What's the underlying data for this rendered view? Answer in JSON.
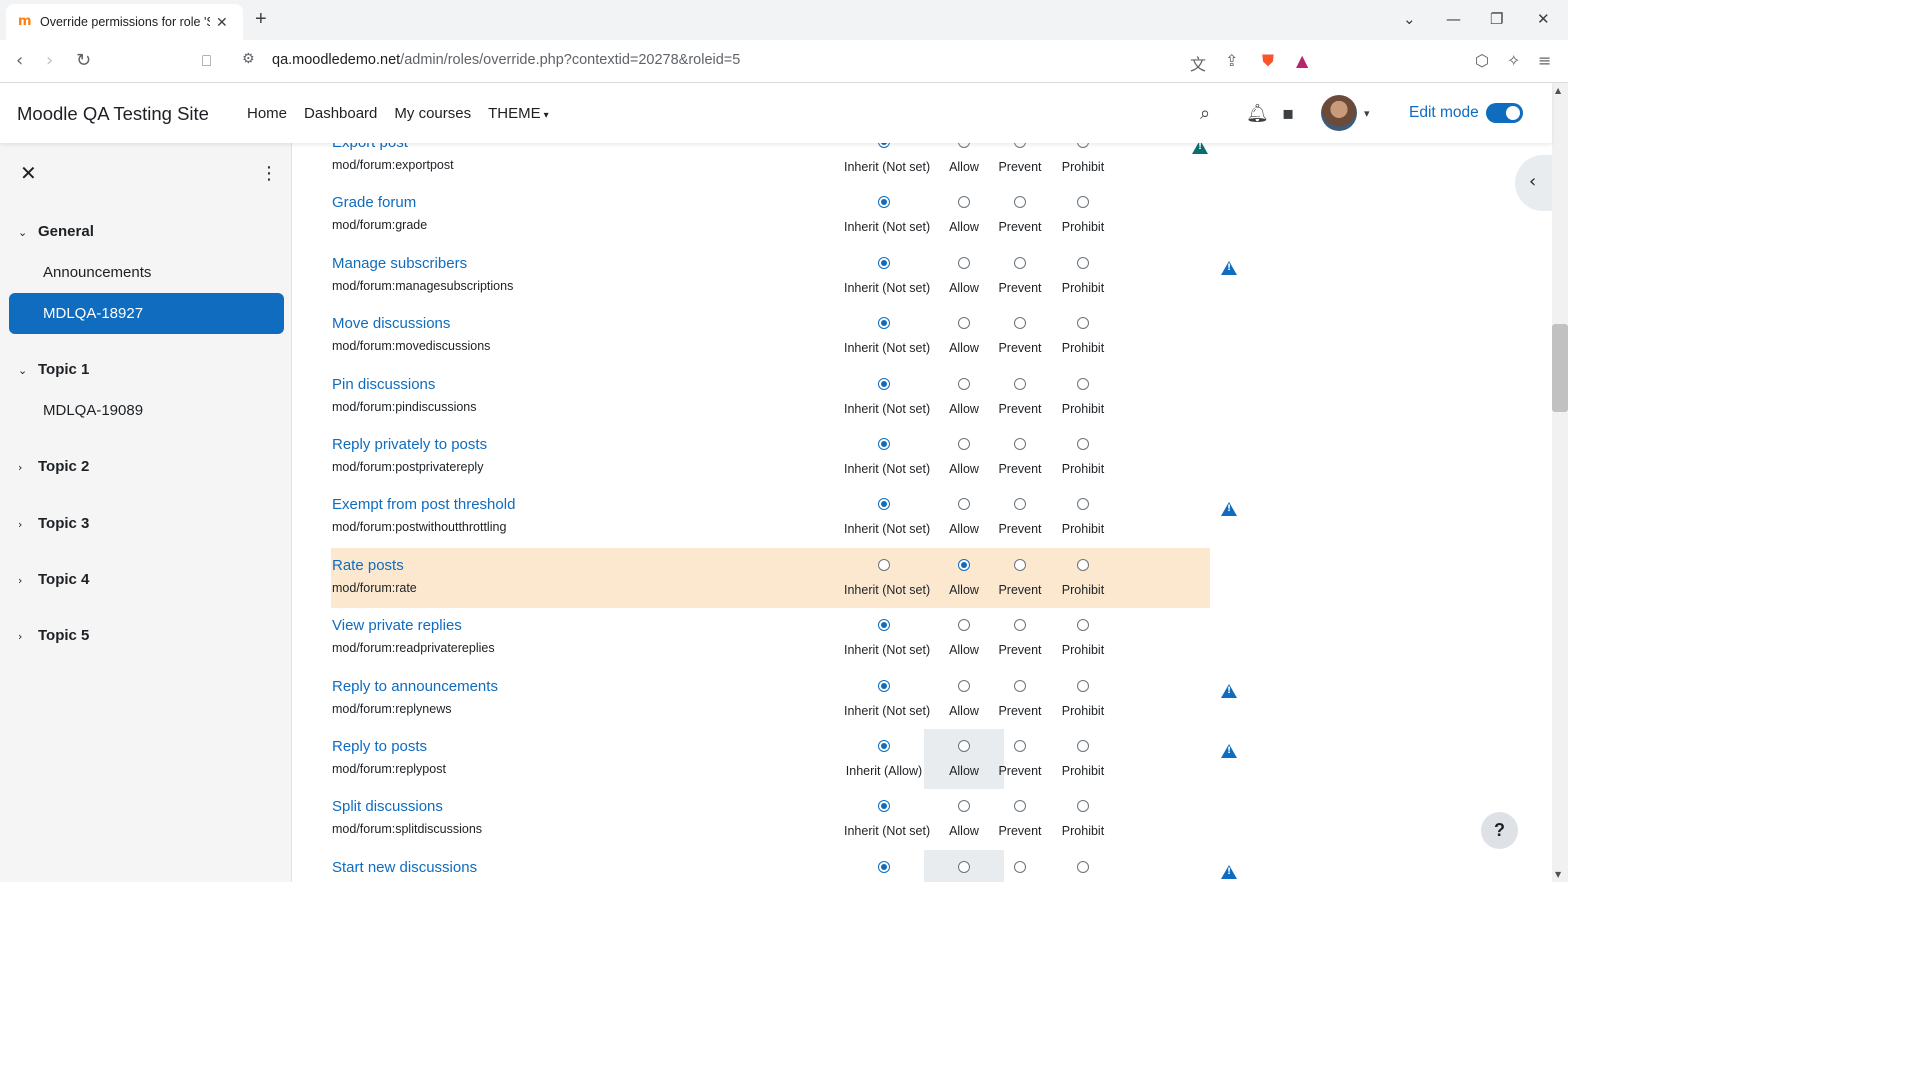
{
  "browser": {
    "tab_title": "Override permissions for role 'S",
    "favicon": "m",
    "url_host": "qa.moodledemo.net",
    "url_path": "/admin/roles/override.php?contextid=20278&roleid=5"
  },
  "header": {
    "site_name": "Moodle QA Testing Site",
    "nav": [
      "Home",
      "Dashboard",
      "My courses",
      "THEME"
    ],
    "edit_mode_label": "Edit mode"
  },
  "drawer": {
    "sections": [
      {
        "title": "General",
        "activities": [
          "Announcements",
          "MDLQA-18927"
        ]
      },
      {
        "title": "Topic 1",
        "activities": [
          "MDLQA-19089"
        ]
      },
      {
        "title": "Topic 2",
        "activities": []
      },
      {
        "title": "Topic 3",
        "activities": []
      },
      {
        "title": "Topic 4",
        "activities": []
      },
      {
        "title": "Topic 5",
        "activities": []
      }
    ],
    "active_activity": "MDLQA-18927"
  },
  "permission_options": [
    "Inherit (Not set)",
    "Allow",
    "Prevent",
    "Prohibit"
  ],
  "permissions": [
    {
      "name": "Export post",
      "capability": "mod/forum:exportpost",
      "selected": 0,
      "inherit_label": "Inherit (Not set)",
      "risk": "teal"
    },
    {
      "name": "Grade forum",
      "capability": "mod/forum:grade",
      "selected": 0,
      "inherit_label": "Inherit (Not set)",
      "risk": ""
    },
    {
      "name": "Manage subscribers",
      "capability": "mod/forum:managesubscriptions",
      "selected": 0,
      "inherit_label": "Inherit (Not set)",
      "risk": "blue"
    },
    {
      "name": "Move discussions",
      "capability": "mod/forum:movediscussions",
      "selected": 0,
      "inherit_label": "Inherit (Not set)",
      "risk": ""
    },
    {
      "name": "Pin discussions",
      "capability": "mod/forum:pindiscussions",
      "selected": 0,
      "inherit_label": "Inherit (Not set)",
      "risk": ""
    },
    {
      "name": "Reply privately to posts",
      "capability": "mod/forum:postprivatereply",
      "selected": 0,
      "inherit_label": "Inherit (Not set)",
      "risk": ""
    },
    {
      "name": "Exempt from post threshold",
      "capability": "mod/forum:postwithoutthrottling",
      "selected": 0,
      "inherit_label": "Inherit (Not set)",
      "risk": "blue"
    },
    {
      "name": "Rate posts",
      "capability": "mod/forum:rate",
      "selected": 1,
      "inherit_label": "Inherit (Not set)",
      "risk": "",
      "highlight": true
    },
    {
      "name": "View private replies",
      "capability": "mod/forum:readprivatereplies",
      "selected": 0,
      "inherit_label": "Inherit (Not set)",
      "risk": ""
    },
    {
      "name": "Reply to announcements",
      "capability": "mod/forum:replynews",
      "selected": 0,
      "inherit_label": "Inherit (Not set)",
      "risk": "blue"
    },
    {
      "name": "Reply to posts",
      "capability": "mod/forum:replypost",
      "selected": 0,
      "inherit_label": "Inherit (Allow)",
      "risk": "blue",
      "allow_shaded": true
    },
    {
      "name": "Split discussions",
      "capability": "mod/forum:splitdiscussions",
      "selected": 0,
      "inherit_label": "Inherit (Not set)",
      "risk": ""
    },
    {
      "name": "Start new discussions",
      "capability": "",
      "selected": 0,
      "inherit_label": "",
      "risk": "blue",
      "allow_shaded": true
    }
  ],
  "help_label": "?"
}
